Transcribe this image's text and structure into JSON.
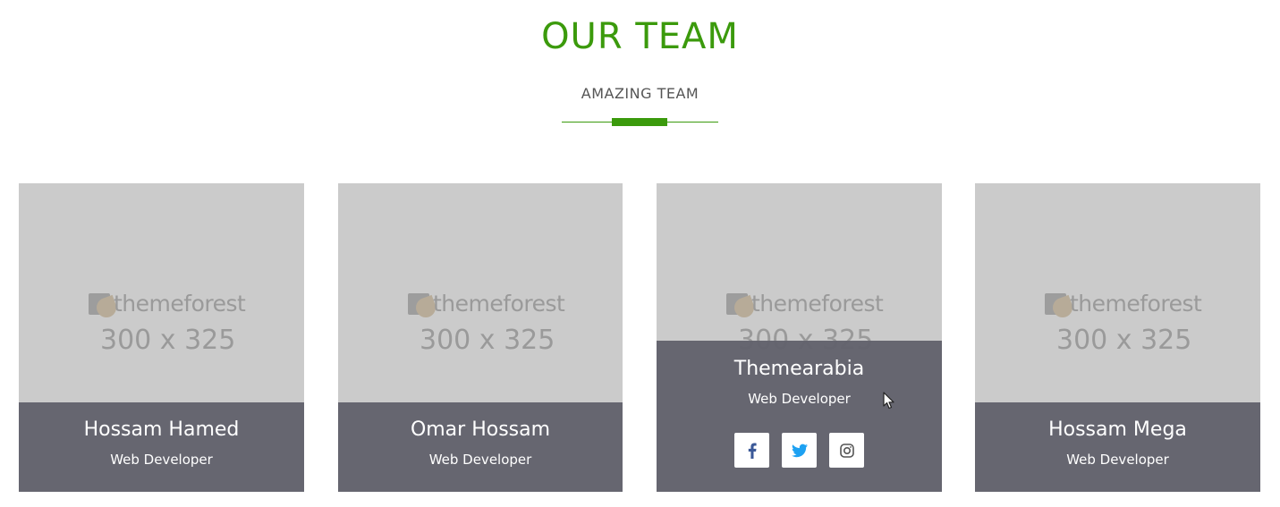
{
  "section": {
    "title": "OUR TEAM",
    "subtitle": "AMAZING TEAM"
  },
  "placeholder": {
    "brand": "themeforest",
    "size": "300 x 325"
  },
  "members": [
    {
      "name": "Hossam Hamed",
      "role": "Web Developer"
    },
    {
      "name": "Omar Hossam",
      "role": "Web Developer"
    },
    {
      "name": "Themearabia",
      "role": "Web Developer"
    },
    {
      "name": "Hossam Mega",
      "role": "Web Developer"
    }
  ],
  "socials": [
    {
      "icon": "facebook-icon",
      "color": "#3b5998"
    },
    {
      "icon": "twitter-icon",
      "color": "#1da1f2"
    },
    {
      "icon": "instagram-icon",
      "color": "#555555"
    }
  ],
  "colors": {
    "accent": "#3b9a0c",
    "card_overlay": "#62626c",
    "placeholder_bg": "#cbcbcb"
  }
}
